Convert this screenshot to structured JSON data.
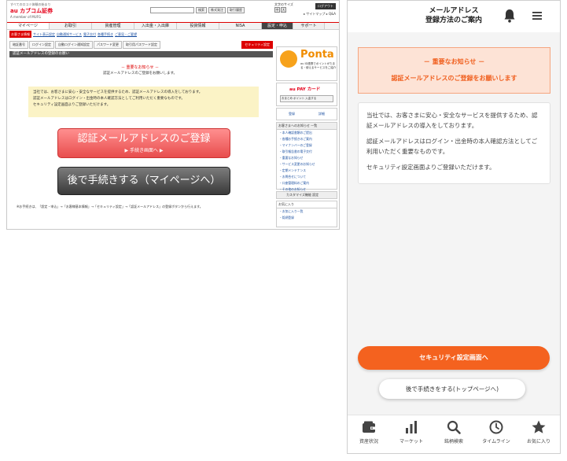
{
  "desktop": {
    "tagline": "すべての口コミ体験の始まり",
    "logo": "au カブコム証券",
    "logo_sub": "A member of MUFG",
    "search_button": "検索",
    "search_extra": [
      "株式発注",
      "取引履歴"
    ],
    "font_size_label": "文字のサイズ",
    "font_size_options": [
      "中",
      "大"
    ],
    "logout": "ログアウト",
    "toplinks": "▸ サイトマップ ▸ Q&A",
    "gnav": [
      "マイページ",
      "お取引",
      "資産管理",
      "入出金・入出庫",
      "投資情報",
      "NISA"
    ],
    "gnav_setting": "設定・申込",
    "gnav_support": "サポート",
    "subnav": [
      "お客さま情報",
      "サイト表示設定",
      "自動通知サービス",
      "電子交付",
      "各種手続き",
      "ご意見・ご要望"
    ],
    "tabs": [
      "暗証番号",
      "ログイン設定",
      "自動ログイン通知設定",
      "パスワード変更",
      "取引用パスワード設定"
    ],
    "tab_security": "セキュリティ設定",
    "page_title": "認証メールアドレスの登録のお願い",
    "notice_title": "－ 重要なお知らせ －",
    "notice_sub": "認証メールアドレスのご登録をお願いします。",
    "info_lines": [
      "当社では、お客さまに安心・安全なサービスを提供するため、認証メールアドレスの導入をしております。",
      "認証メールアドレスはログイン・出金時の本人確認方法としてご利用いただく重要なものです。",
      "セキュリティ設定画面よりご登録いただけます。"
    ],
    "register_button": "認証メールアドレスのご登録",
    "register_sub": "▶ 手続き画面へ ▶",
    "later_button": "後で手続きする（マイページへ）",
    "footnote": "※お手続きは、「設定・申込」→「お客様基本情報」→「セキュリティ設定」→「認証メールアドレス」の登録ボタンから行えます。",
    "ponta_title": "Ponta",
    "ponta_text": "au ID連携でポイントがたまる・使えるサービスをご紹介",
    "aupay_title": "au PAY カード",
    "aupay_button": "おまとめ ポイント 入金する",
    "side_links": [
      "登録",
      "詳細"
    ],
    "news_title": "お客さまへのお知らせ",
    "news_more": "一覧",
    "news_items": [
      "・本人確認書類のご提出",
      "・各種お手続きのご案内",
      "・マイナンバーのご登録",
      "・取引報告書の電子交付",
      "・重要なお知らせ",
      "・サービス変更のお知らせ",
      "・定期メンテナンス",
      "・お問合せについて",
      "・口座管理料のご案内",
      "・その他のお知らせ"
    ],
    "custom_label": "カスタマイズ機能",
    "custom_btn": "設定",
    "fav_title": "お気に入り",
    "fav_items": [
      "・お気に入り一覧",
      "・銘柄登録"
    ]
  },
  "mobile": {
    "title_line1": "メールアドレス",
    "title_line2": "登録方法のご案内",
    "alert_line1": "－ 重要なお知らせ －",
    "alert_line2": "認証メールアドレスのご登録をお願いします",
    "message": [
      "当社では、お客さまに安心・安全なサービスを提供するため、認証メールアドレスの導入をしております。",
      "認証メールアドレスはログイン・出金時の本人確認方法としてご利用いただく重要なものです。",
      "セキュリティ設定画面よりご登録いただけます。"
    ],
    "primary_button": "セキュリティ設定画面へ",
    "secondary_button": "後で手続きをする(トップページへ)",
    "tabs": [
      "資産状況",
      "マーケット",
      "銘柄検索",
      "タイムライン",
      "お気に入り"
    ]
  },
  "colors": {
    "accent_orange": "#f4621f",
    "alert_bg": "#fde3d6",
    "desktop_red": "#e5001a"
  }
}
